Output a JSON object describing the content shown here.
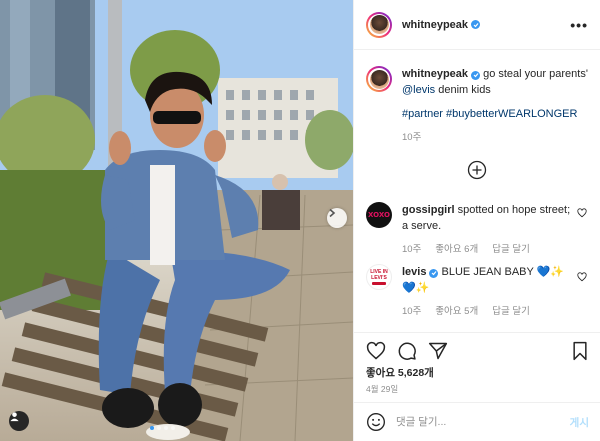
{
  "post": {
    "username": "whitneypeak",
    "more_label": "•••"
  },
  "caption": {
    "username": "whitneypeak",
    "text_before": " go steal your parents' ",
    "mention": "@levis",
    "text_after": " denim kids",
    "hashtags": "#partner #buybetterWEARLONGER",
    "age": "10주"
  },
  "comments": [
    {
      "username": "gossipgirl",
      "avatar_text": "XOXO",
      "text": " spotted on hope street; a serve.",
      "age": "10주",
      "likes": "좋아요 6개",
      "reply": "답글 달기"
    },
    {
      "username": "levis",
      "avatar_text": "LIVE IN LEVI'S",
      "text": " BLUE JEAN BABY 💙✨💙✨",
      "age": "10주",
      "likes": "좋아요 5개",
      "reply": "답글 달기"
    }
  ],
  "stats": {
    "likes": "좋아요 5,628개",
    "date": "4월 29일"
  },
  "comment_input": {
    "placeholder": "댓글 달기...",
    "post_label": "게시"
  },
  "icons": {
    "heart": "heart-icon",
    "comment": "comment-icon",
    "share": "share-icon",
    "bookmark": "bookmark-icon",
    "emoji": "emoji-icon",
    "add": "plus-circle-icon",
    "next": "chevron-right-icon",
    "tag": "user-tag-icon"
  },
  "colors": {
    "verified": "#3897f0",
    "link": "#00376b",
    "muted": "#8e8e8e",
    "post_button": "#b2dffc"
  }
}
